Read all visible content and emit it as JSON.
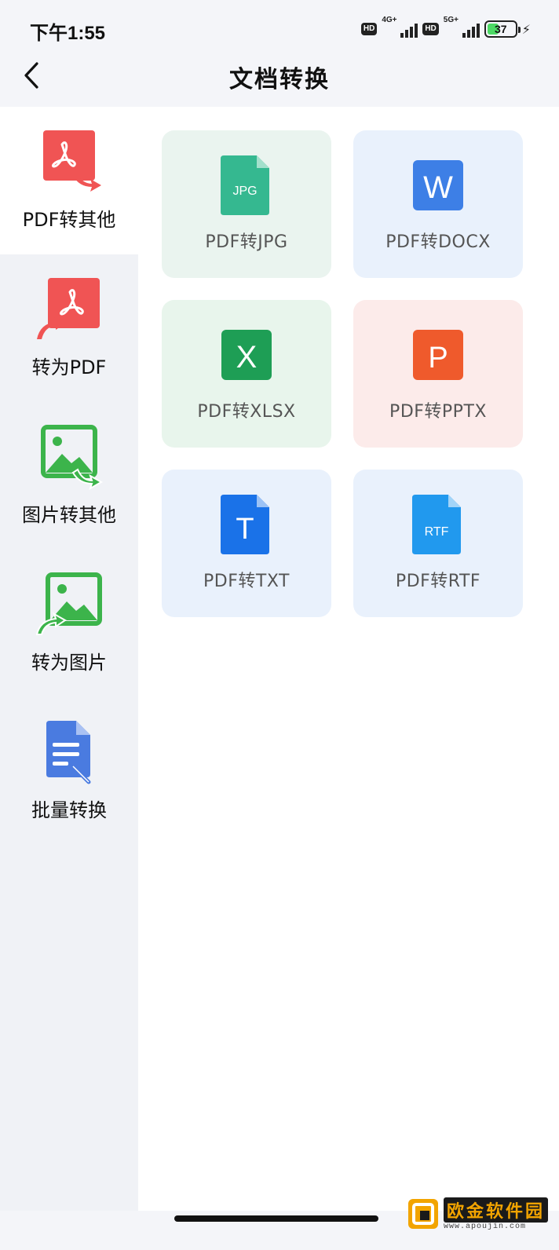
{
  "status_bar": {
    "time": "下午1:55",
    "hd_badge_1": "HD",
    "network_1": "4G+",
    "hd_badge_2": "HD",
    "network_2": "5G+",
    "battery": "37"
  },
  "header": {
    "title": "文档转换"
  },
  "sidebar": {
    "items": [
      {
        "label": "PDF转其他",
        "icon": "pdf-convert-out-icon",
        "active": true
      },
      {
        "label": "转为PDF",
        "icon": "pdf-convert-in-icon",
        "active": false
      },
      {
        "label": "图片转其他",
        "icon": "image-convert-out-icon",
        "active": false
      },
      {
        "label": "转为图片",
        "icon": "image-convert-in-icon",
        "active": false
      },
      {
        "label": "批量转换",
        "icon": "batch-convert-icon",
        "active": false
      }
    ]
  },
  "cards": [
    {
      "label": "PDF转JPG",
      "icon_text": "JPG",
      "icon": "jpg-file-icon"
    },
    {
      "label": "PDF转DOCX",
      "icon_text": "W",
      "icon": "word-icon"
    },
    {
      "label": "PDF转XLSX",
      "icon_text": "X",
      "icon": "excel-icon"
    },
    {
      "label": "PDF转PPTX",
      "icon_text": "P",
      "icon": "powerpoint-icon"
    },
    {
      "label": "PDF转TXT",
      "icon_text": "T",
      "icon": "txt-file-icon"
    },
    {
      "label": "PDF转RTF",
      "icon_text": "RTF",
      "icon": "rtf-file-icon"
    }
  ],
  "watermark": {
    "title": "欧金软件园",
    "url": "www.apoujin.com"
  },
  "colors": {
    "pdf_red": "#f05454",
    "image_green": "#3cb44b",
    "batch_blue": "#4a7be0",
    "jpg_teal": "#35b890",
    "word_blue": "#3d7fe6",
    "excel_green": "#1e9e55",
    "ppt_orange": "#ef5a2c",
    "txt_blue": "#1a72e8",
    "rtf_blue": "#2199ee"
  }
}
